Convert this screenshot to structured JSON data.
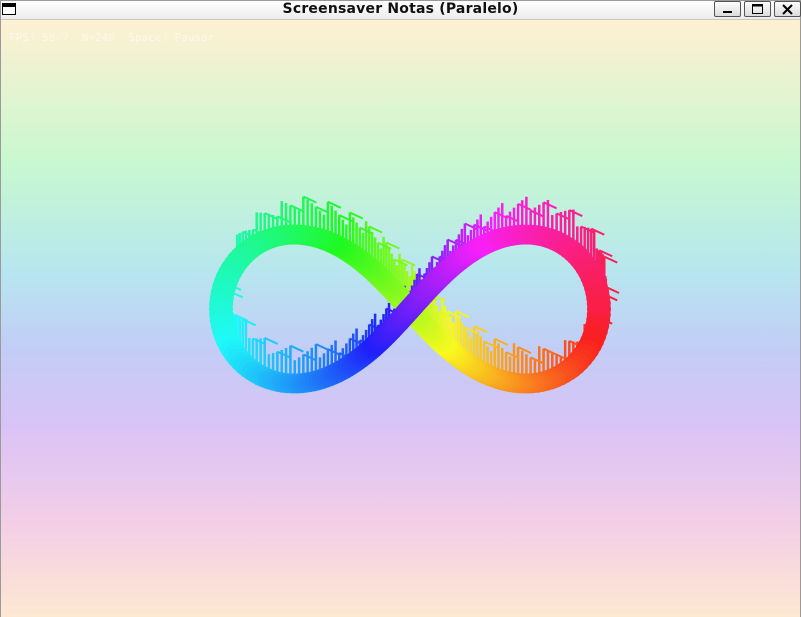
{
  "window": {
    "title": "Screensaver Notas (Paralelo)",
    "controls": {
      "minimize_icon": "minimize-icon",
      "maximize_icon": "maximize-icon",
      "close_icon": "close-icon"
    }
  },
  "hud": {
    "text": "FPS: 58.7  N=240  Space: Pausar"
  },
  "visual": {
    "shape": "infinity-loop-of-notes",
    "colors": [
      "#ff2a2a",
      "#ff8c1a",
      "#ffd21a",
      "#b8ff1a",
      "#2aff2a",
      "#1affb4",
      "#1ad2ff",
      "#2a7aff",
      "#3a1aff",
      "#c21aff",
      "#ff1ac2"
    ]
  }
}
